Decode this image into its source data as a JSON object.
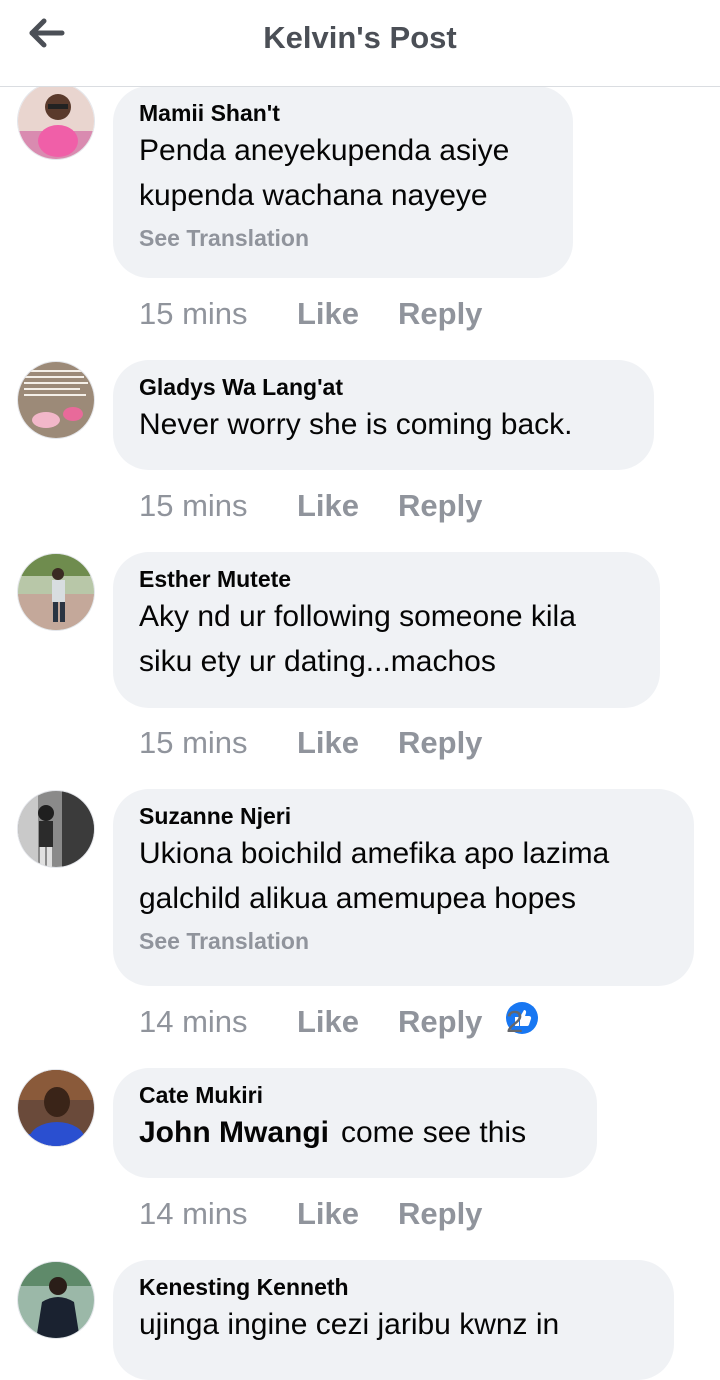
{
  "header": {
    "title": "Kelvin's Post"
  },
  "comments": [
    {
      "author": "Mamii Shan't",
      "text": "Penda aneyekupenda asiye kupenda wachana nayeye",
      "see_translation": "See Translation",
      "time": "15 mins",
      "like": "Like",
      "reply": "Reply"
    },
    {
      "author": "Gladys Wa Lang'at",
      "text": "Never worry she is coming back.",
      "time": "15 mins",
      "like": "Like",
      "reply": "Reply"
    },
    {
      "author": "Esther Mutete",
      "text": "Aky nd ur following someone kila siku ety ur dating...machos",
      "time": "15 mins",
      "like": "Like",
      "reply": "Reply"
    },
    {
      "author": "Suzanne Njeri",
      "text": "Ukiona boichild amefika apo lazima galchild alikua amemupea hopes",
      "see_translation": "See Translation",
      "time": "14 mins",
      "like": "Like",
      "reply": "Reply",
      "reaction_count": "2"
    },
    {
      "author": "Cate Mukiri",
      "mention": "John Mwangi",
      "text": "come see this",
      "time": "14 mins",
      "like": "Like",
      "reply": "Reply"
    },
    {
      "author": "Kenesting Kenneth",
      "text": "ujinga ingine cezi jaribu kwnz in"
    }
  ],
  "colors": {
    "bubble": "#f0f2f5",
    "meta_gray": "#90949c",
    "like_blue": "#1877f2"
  },
  "icons": {
    "back": "arrow-left-icon",
    "reaction": "thumbs-up-icon"
  }
}
